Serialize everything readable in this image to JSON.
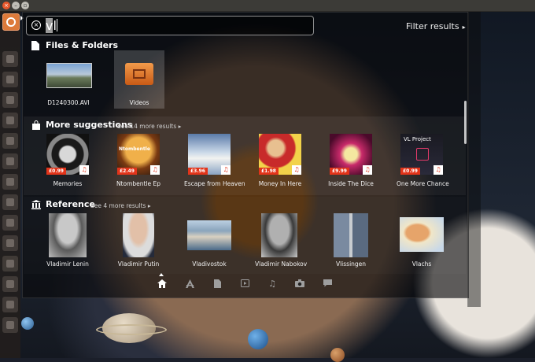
{
  "search": {
    "query_selected": "v",
    "query_rest": "l"
  },
  "filter": {
    "label": "Filter results"
  },
  "files": {
    "title": "Files & Folders",
    "items": [
      {
        "label": "D1240300.AVI"
      },
      {
        "label": "Videos"
      }
    ]
  },
  "suggestions": {
    "title": "More suggestions",
    "see_more": "See 14 more results",
    "items": [
      {
        "label": "Memories",
        "price": "£0.99"
      },
      {
        "label": "Ntombentle Ep",
        "price": "£2.49"
      },
      {
        "label": "Escape from Heaven",
        "price": "£3.96"
      },
      {
        "label": "Money In Here",
        "price": "£1.98"
      },
      {
        "label": "Inside The Dice",
        "price": "£9.99"
      },
      {
        "label": "One More Chance",
        "price": "£0.99"
      }
    ]
  },
  "reference": {
    "title": "Reference",
    "see_more": "See 4 more results",
    "items": [
      {
        "label": "Vladimir Lenin"
      },
      {
        "label": "Vladimir Putin"
      },
      {
        "label": "Vladivostok"
      },
      {
        "label": "Vladimir Nabokov"
      },
      {
        "label": "Vlissingen"
      },
      {
        "label": "Vlachs"
      }
    ]
  },
  "album_text": {
    "ntombentle": "Ntombentle",
    "vl_project": "VL Project"
  },
  "colors": {
    "price_tag": "#e2341a",
    "launcher_home": "#dd7a3a"
  }
}
